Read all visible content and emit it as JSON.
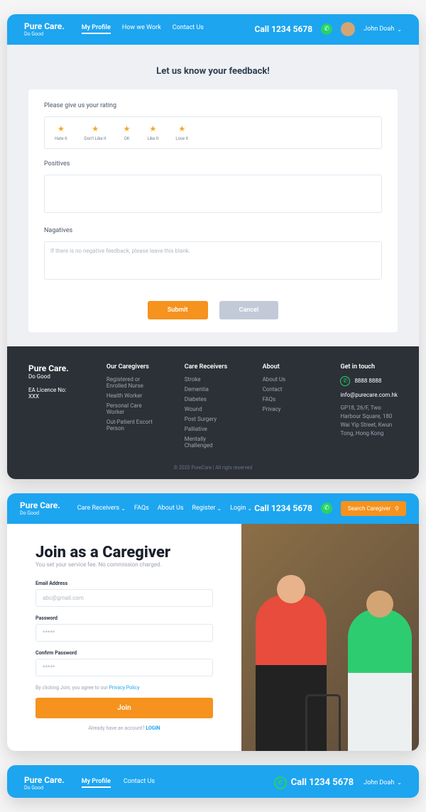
{
  "brand": {
    "name": "Pure Care.",
    "tagline": "Do Good"
  },
  "s1": {
    "nav": [
      "My Profile",
      "How we Work",
      "Contact Us"
    ],
    "phone": "Call 1234 5678",
    "user": "John Doah",
    "title": "Let us know your feedback!",
    "rating_lbl": "Please give us your rating",
    "ratings": [
      "Hate It",
      "Don't Like It",
      "OK",
      "Like It",
      "Love It"
    ],
    "pos_lbl": "Positives",
    "neg_lbl": "Nagatives",
    "neg_ph": "If there is no negative feedback, please leave this blank.",
    "submit": "Submit",
    "cancel": "Cancel"
  },
  "footer": {
    "licence": "EA Licence No: XXX",
    "c1_h": "Our Caregivers",
    "c1": [
      "Registered or Enrolled Nurse",
      "Health Worker",
      "Personal Care Worker",
      "Out-Patient Escort Person"
    ],
    "c2_h": "Care Receivers",
    "c2": [
      "Stroke",
      "Dementia",
      "Diabetes",
      "Wound",
      "Post Surgery",
      "Palliative",
      "Mentally Challenged"
    ],
    "c3_h": "About",
    "c3": [
      "About Us",
      "Contact",
      "FAQs",
      "Privacy"
    ],
    "c4_h": "Get in touch",
    "phone": "8888 8888",
    "email": "info@purecare.com.hk",
    "addr": "GP18, 26/F, Two Harbour Square, 180 Wai Yip Street, Kwun Tong, Hong Kong",
    "copy": "© 2020 PureCare   |   All rigts reserved"
  },
  "s2": {
    "nav": [
      "Care Receivers",
      "FAQs",
      "About Us",
      "Register",
      "Login"
    ],
    "phone": "Call 1234 5678",
    "search": "Search Caregiver",
    "title": "Join as a Caregiver",
    "sub": "You set your service fee. No commission charged.",
    "email_lbl": "Email Address",
    "email_ph": "abc@gmail.com",
    "pw_lbl": "Password",
    "pw_ph": "*****",
    "cpw_lbl": "Confirm Password",
    "cpw_ph": "*****",
    "terms_pre": "By clicking Join, you agree to our ",
    "terms_link": "Privacy Policy",
    "join": "Join",
    "have_pre": "Already have an account? ",
    "have_link": "LOGIN"
  },
  "s3": {
    "nav": [
      "My Profile",
      "Contact Us"
    ],
    "phone": "Call 1234 5678",
    "user": "John Doah"
  }
}
